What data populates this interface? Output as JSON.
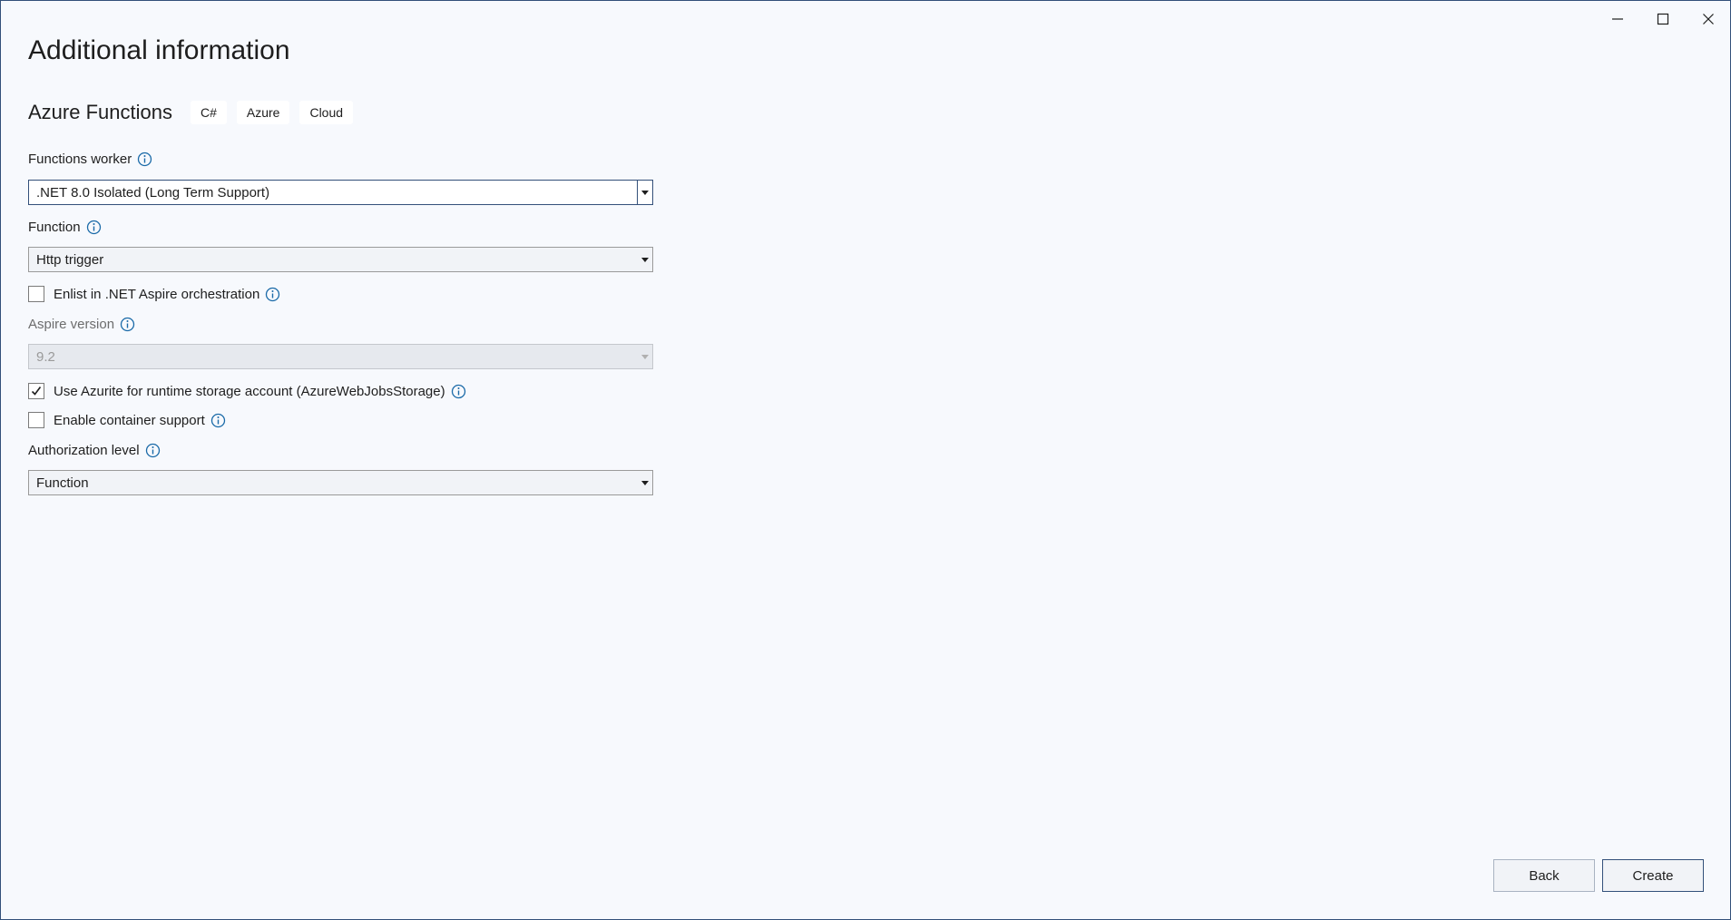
{
  "window": {
    "title": "Additional information",
    "controls": [
      "minimize-icon",
      "maximize-icon",
      "close-icon"
    ]
  },
  "template": {
    "name": "Azure Functions",
    "tags": [
      "C#",
      "Azure",
      "Cloud"
    ]
  },
  "form": {
    "functions_worker": {
      "label": "Functions worker",
      "value": ".NET 8.0 Isolated (Long Term Support)"
    },
    "function": {
      "label": "Function",
      "value": "Http trigger"
    },
    "enlist_aspire": {
      "label": "Enlist in .NET Aspire orchestration",
      "checked": false
    },
    "aspire_version": {
      "label": "Aspire version",
      "value": "9.2",
      "disabled": true
    },
    "use_azurite": {
      "label": "Use Azurite for runtime storage account (AzureWebJobsStorage)",
      "checked": true
    },
    "container_support": {
      "label": "Enable container support",
      "checked": false
    },
    "authorization_level": {
      "label": "Authorization level",
      "value": "Function"
    }
  },
  "footer": {
    "back_label": "Back",
    "create_label": "Create"
  },
  "colors": {
    "background": "#f7f9fd",
    "accent": "#33507a",
    "info_icon": "#1a6aa8"
  }
}
